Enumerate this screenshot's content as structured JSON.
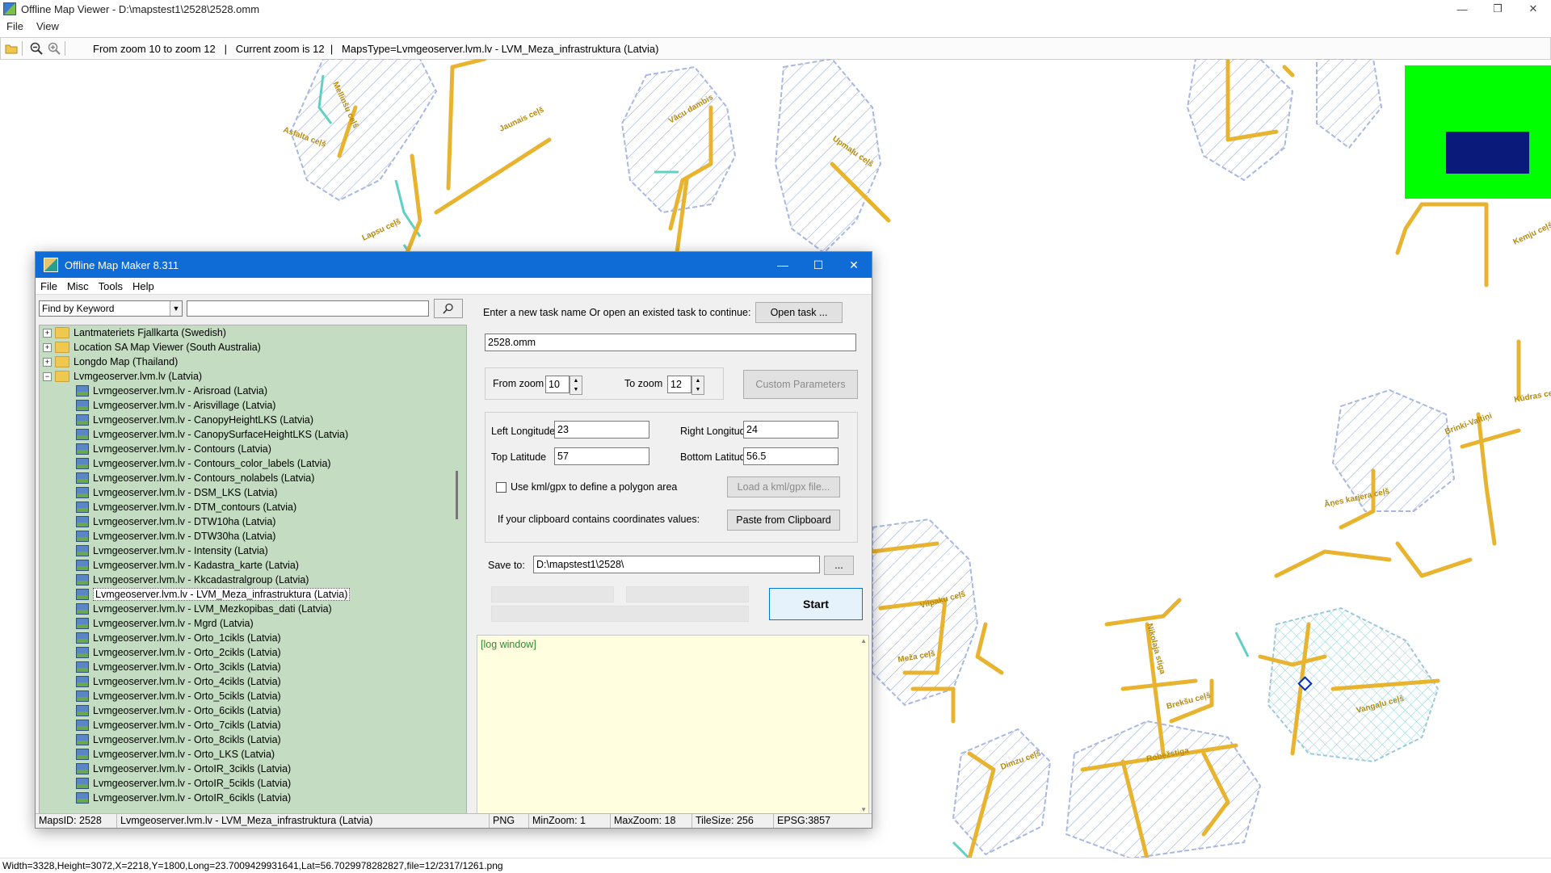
{
  "viewer": {
    "title": "Offline Map Viewer - D:\\mapstest1\\2528\\2528.omm",
    "menu": [
      "File",
      "View"
    ],
    "toolbar_info": "From zoom 10 to zoom 12   |   Current zoom is 12  |   MapsType=Lvmgeoserver.lvm.lv - LVM_Meza_infrastruktura (Latvia)",
    "status": "Width=3328,Height=3072,X=2218,Y=1800,Long=23.7009429931641,Lat=56.7029978282827,file=12/2317/1261.png"
  },
  "map_labels": [
    "Asfalta ceļš",
    "Mellinšu ceļš",
    "Jaunais ceļš",
    "Vācu dambis",
    "Upmaļu ceļš",
    "Lapsu ceļš",
    "Meža ceļš",
    "Vilpaķu ceļš",
    "Nikolaja stiga",
    "Brekšu ceļš",
    "Robežstiga",
    "Vangaļu ceļš",
    "Dimzu ceļš",
    "Kūdras ceļš",
    "Brinki-Valtiņi",
    "Āņes karjera ceļš",
    "Kemju ceļš"
  ],
  "dialog": {
    "title": "Offline Map Maker 8.311",
    "menu": [
      "File",
      "Misc",
      "Tools",
      "Help"
    ],
    "search_mode": "Find by Keyword",
    "search_value": "",
    "tree": [
      {
        "type": "folder",
        "label": "Lantmateriets Fjallkarta (Swedish)",
        "expanded": false
      },
      {
        "type": "folder",
        "label": "Location SA Map Viewer (South Australia)",
        "expanded": false
      },
      {
        "type": "folder",
        "label": "Longdo Map (Thailand)",
        "expanded": false
      },
      {
        "type": "folder",
        "label": "Lvmgeoserver.lvm.lv (Latvia)",
        "expanded": true
      },
      {
        "type": "map",
        "label": "Lvmgeoserver.lvm.lv - Arisroad (Latvia)"
      },
      {
        "type": "map",
        "label": "Lvmgeoserver.lvm.lv - Arisvillage (Latvia)"
      },
      {
        "type": "map",
        "label": "Lvmgeoserver.lvm.lv - CanopyHeightLKS (Latvia)"
      },
      {
        "type": "map",
        "label": "Lvmgeoserver.lvm.lv - CanopySurfaceHeightLKS (Latvia)"
      },
      {
        "type": "map",
        "label": "Lvmgeoserver.lvm.lv - Contours (Latvia)"
      },
      {
        "type": "map",
        "label": "Lvmgeoserver.lvm.lv - Contours_color_labels (Latvia)"
      },
      {
        "type": "map",
        "label": "Lvmgeoserver.lvm.lv - Contours_nolabels (Latvia)"
      },
      {
        "type": "map",
        "label": "Lvmgeoserver.lvm.lv - DSM_LKS (Latvia)"
      },
      {
        "type": "map",
        "label": "Lvmgeoserver.lvm.lv - DTM_contours (Latvia)"
      },
      {
        "type": "map",
        "label": "Lvmgeoserver.lvm.lv - DTW10ha (Latvia)"
      },
      {
        "type": "map",
        "label": "Lvmgeoserver.lvm.lv - DTW30ha (Latvia)"
      },
      {
        "type": "map",
        "label": "Lvmgeoserver.lvm.lv - Intensity (Latvia)"
      },
      {
        "type": "map",
        "label": "Lvmgeoserver.lvm.lv - Kadastra_karte (Latvia)"
      },
      {
        "type": "map",
        "label": "Lvmgeoserver.lvm.lv - Kkcadastralgroup (Latvia)"
      },
      {
        "type": "map",
        "label": "Lvmgeoserver.lvm.lv - LVM_Meza_infrastruktura (Latvia)",
        "selected": true
      },
      {
        "type": "map",
        "label": "Lvmgeoserver.lvm.lv - LVM_Mezkopibas_dati (Latvia)"
      },
      {
        "type": "map",
        "label": "Lvmgeoserver.lvm.lv - Mgrd (Latvia)"
      },
      {
        "type": "map",
        "label": "Lvmgeoserver.lvm.lv - Orto_1cikls (Latvia)"
      },
      {
        "type": "map",
        "label": "Lvmgeoserver.lvm.lv - Orto_2cikls (Latvia)"
      },
      {
        "type": "map",
        "label": "Lvmgeoserver.lvm.lv - Orto_3cikls (Latvia)"
      },
      {
        "type": "map",
        "label": "Lvmgeoserver.lvm.lv - Orto_4cikls (Latvia)"
      },
      {
        "type": "map",
        "label": "Lvmgeoserver.lvm.lv - Orto_5cikls (Latvia)"
      },
      {
        "type": "map",
        "label": "Lvmgeoserver.lvm.lv - Orto_6cikls (Latvia)"
      },
      {
        "type": "map",
        "label": "Lvmgeoserver.lvm.lv - Orto_7cikls (Latvia)"
      },
      {
        "type": "map",
        "label": "Lvmgeoserver.lvm.lv - Orto_8cikls (Latvia)"
      },
      {
        "type": "map",
        "label": "Lvmgeoserver.lvm.lv - Orto_LKS (Latvia)"
      },
      {
        "type": "map",
        "label": "Lvmgeoserver.lvm.lv - OrtoIR_3cikls (Latvia)"
      },
      {
        "type": "map",
        "label": "Lvmgeoserver.lvm.lv - OrtoIR_5cikls (Latvia)"
      },
      {
        "type": "map",
        "label": "Lvmgeoserver.lvm.lv - OrtoIR_6cikls (Latvia)"
      }
    ],
    "task_prompt": "Enter a new task name Or open an existed task to continue:",
    "open_task": "Open task ...",
    "task_name": "2528.omm",
    "from_zoom_label": "From zoom",
    "from_zoom": "10",
    "to_zoom_label": "To zoom",
    "to_zoom": "12",
    "custom_params": "Custom Parameters",
    "left_lon_label": "Left Longitude",
    "left_lon": "23",
    "right_lon_label": "Right Longitude",
    "right_lon": "24",
    "top_lat_label": "Top Latitude",
    "top_lat": "57",
    "bottom_lat_label": "Bottom Latitude",
    "bottom_lat": "56.5",
    "kml_check": "Use kml/gpx to define a polygon area",
    "load_kml": "Load a kml/gpx file...",
    "clipboard_label": "If your clipboard contains coordinates values:",
    "paste_btn": "Paste from Clipboard",
    "save_to_label": "Save to:",
    "save_to": "D:\\mapstest1\\2528\\",
    "browse": "...",
    "start": "Start",
    "log": "[log window]",
    "status": [
      "MapsID: 2528",
      "Lvmgeoserver.lvm.lv - LVM_Meza_infrastruktura (Latvia)",
      "PNG",
      "MinZoom: 1",
      "MaxZoom: 18",
      "TileSize: 256",
      "EPSG:3857"
    ]
  },
  "colors": {
    "road": "#e8b430",
    "hatch": "#7f93c9",
    "water": "#5fd1c4",
    "overview_bg": "#00ff00",
    "overview_box": "#0a1a7a",
    "dialog_title": "#0f6cd6",
    "tree_bg": "#c4dcc1",
    "log_bg": "#ffffe0"
  }
}
